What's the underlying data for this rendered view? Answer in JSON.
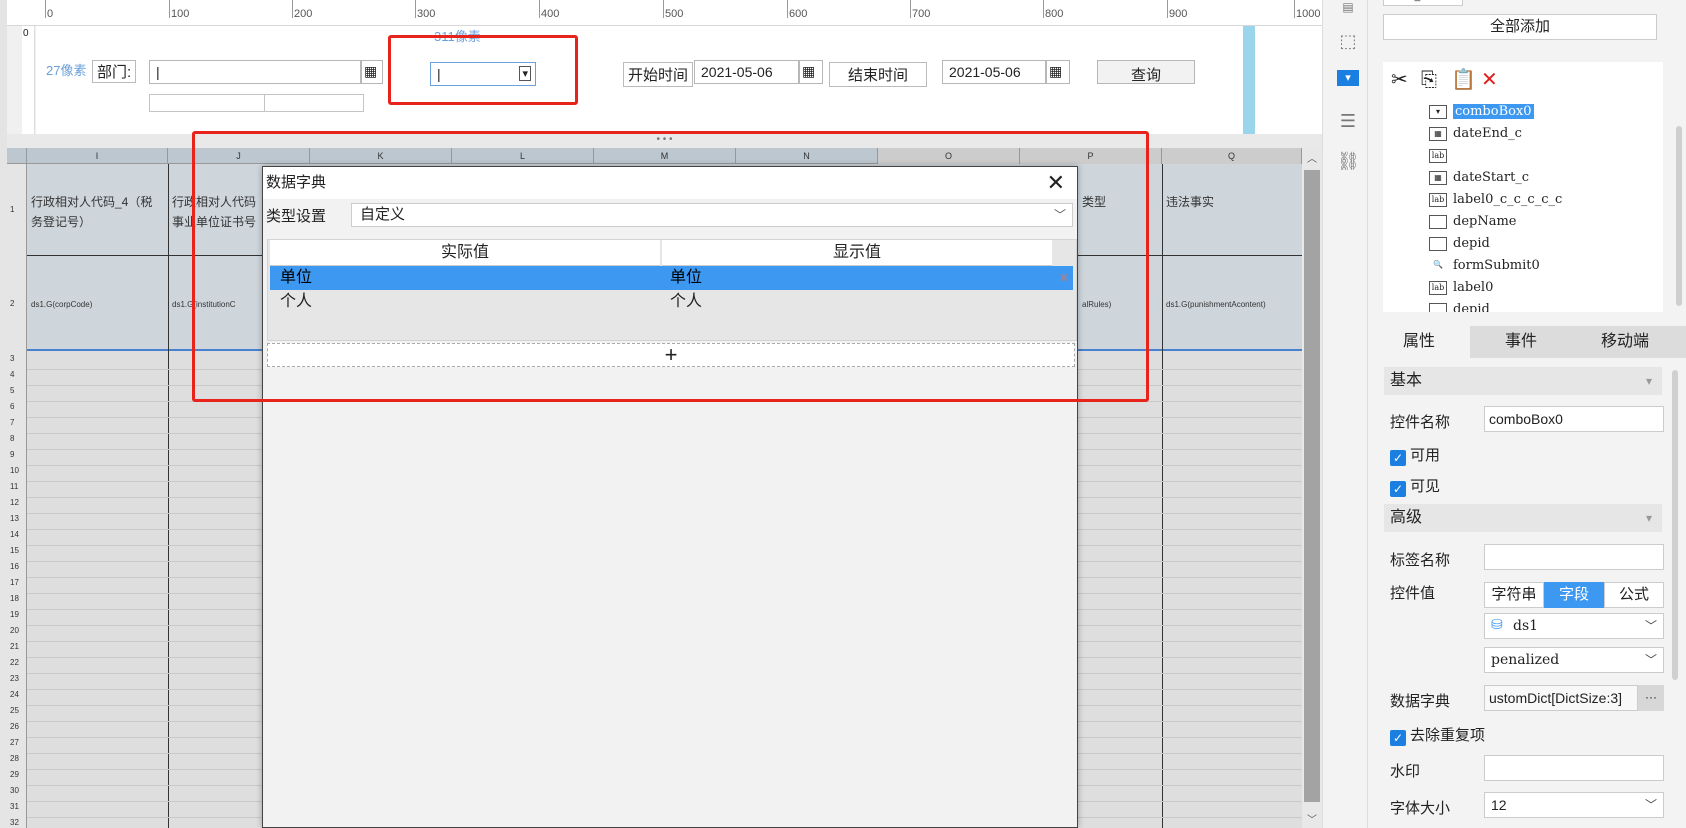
{
  "ruler": {
    "ticks": [
      "0",
      "100",
      "200",
      "300",
      "400",
      "500",
      "600",
      "700",
      "800",
      "900",
      "1000"
    ],
    "left_mark": "0"
  },
  "form": {
    "dept_px": "27像素",
    "dept_label": "部门:",
    "combo_px": "311像素",
    "start_label": "开始时间",
    "start_value": "2021-05-06",
    "end_label": "结束时间",
    "end_value": "2021-05-06",
    "query_button": "查询"
  },
  "grid": {
    "columns": [
      "I",
      "J",
      "K",
      "L",
      "M",
      "N",
      "O",
      "P",
      "Q"
    ],
    "rows": [
      "1",
      "2",
      "3",
      "4",
      "5",
      "6",
      "7",
      "8",
      "9",
      "10",
      "11",
      "12",
      "13",
      "14",
      "15",
      "16",
      "17",
      "18",
      "19",
      "20",
      "21",
      "22",
      "23",
      "24",
      "25",
      "26",
      "27",
      "28",
      "29",
      "30",
      "31",
      "32"
    ],
    "cell_i1": "行政相对人代码_4（税务登记号）",
    "cell_j1": "行政相对人代码事业单位证书号",
    "cell_p1": "类型",
    "cell_q1": "违法事实",
    "cell_i2": "ds1.G(corpCode)",
    "cell_j2": "ds1.G(institutionC",
    "cell_p2": "alRules)",
    "cell_q2": "ds1.G(punishmentAcontent)"
  },
  "dialog": {
    "title": "数据字典",
    "type_label": "类型设置",
    "type_value": "自定义",
    "col_actual": "实际值",
    "col_display": "显示值",
    "rows": [
      {
        "actual": "单位",
        "display": "单位"
      },
      {
        "actual": "个人",
        "display": "个人"
      }
    ],
    "add_symbol": "+"
  },
  "panel": {
    "top_chip": "ds_base",
    "add_all": "全部添加",
    "tree": [
      "comboBox0",
      "dateEnd_c",
      "",
      "dateStart_c",
      "label0_c_c_c_c_c",
      "depName",
      "depid",
      "formSubmit0",
      "label0",
      "depid"
    ],
    "tabs": [
      "属性",
      "事件",
      "移动端"
    ],
    "basic": "基本",
    "control_name_label": "控件名称",
    "control_name": "comboBox0",
    "enabled": "可用",
    "visible": "可见",
    "advanced": "高级",
    "tag_name_label": "标签名称",
    "control_value_label": "控件值",
    "seg": [
      "字符串",
      "字段",
      "公式"
    ],
    "ds": "ds1",
    "field": "penalized",
    "dict_label": "数据字典",
    "dict_value": "ustomDict[DictSize:3]",
    "dict_more": "···",
    "dedupe": "去除重复项",
    "watermark_label": "水印",
    "font_size_label": "字体大小",
    "font_size": "12"
  },
  "colors": {
    "accent": "#3d98f2",
    "highlight_red": "#e8231c",
    "selected_row": "#3d98f2"
  }
}
